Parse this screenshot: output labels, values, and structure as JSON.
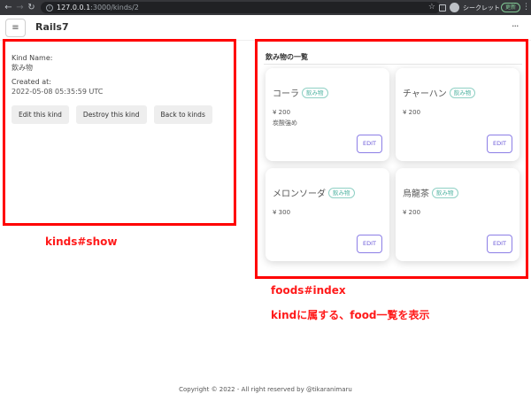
{
  "browser": {
    "url_host": "127.0.0.1",
    "url_path": ":3000/kinds/2",
    "incognito_label": "シークレット",
    "update_label": "更新"
  },
  "header": {
    "brand": "Rails7",
    "menu_icon": "hamburger-icon",
    "more_icon": "ellipsis-icon"
  },
  "show": {
    "kind_name_label": "Kind Name:",
    "kind_name_value": "飲み物",
    "created_at_label": "Created at:",
    "created_at_value": "2022-05-08 05:35:59 UTC",
    "buttons": {
      "edit": "Edit this kind",
      "destroy": "Destroy this kind",
      "back": "Back to kinds"
    }
  },
  "foods": {
    "title": "飲み物の一覧",
    "items": [
      {
        "name": "コーラ",
        "kind": "飲み物",
        "price": "¥ 200",
        "description": "炭酸強め",
        "edit": "EDIT"
      },
      {
        "name": "チャーハン",
        "kind": "飲み物",
        "price": "¥ 200",
        "description": "",
        "edit": "EDIT"
      },
      {
        "name": "メロンソーダ",
        "kind": "飲み物",
        "price": "¥ 300",
        "description": "",
        "edit": "EDIT"
      },
      {
        "name": "烏龍茶",
        "kind": "飲み物",
        "price": "¥ 200",
        "description": "",
        "edit": "EDIT"
      }
    ]
  },
  "annotations": {
    "show_label": "kinds#show",
    "index_label": "foods#index",
    "index_note": "kindに属する、food一覧を表示",
    "color": "#ff0000"
  },
  "footer": "Copyright © 2022 - All right reserved by @tikaranimaru"
}
